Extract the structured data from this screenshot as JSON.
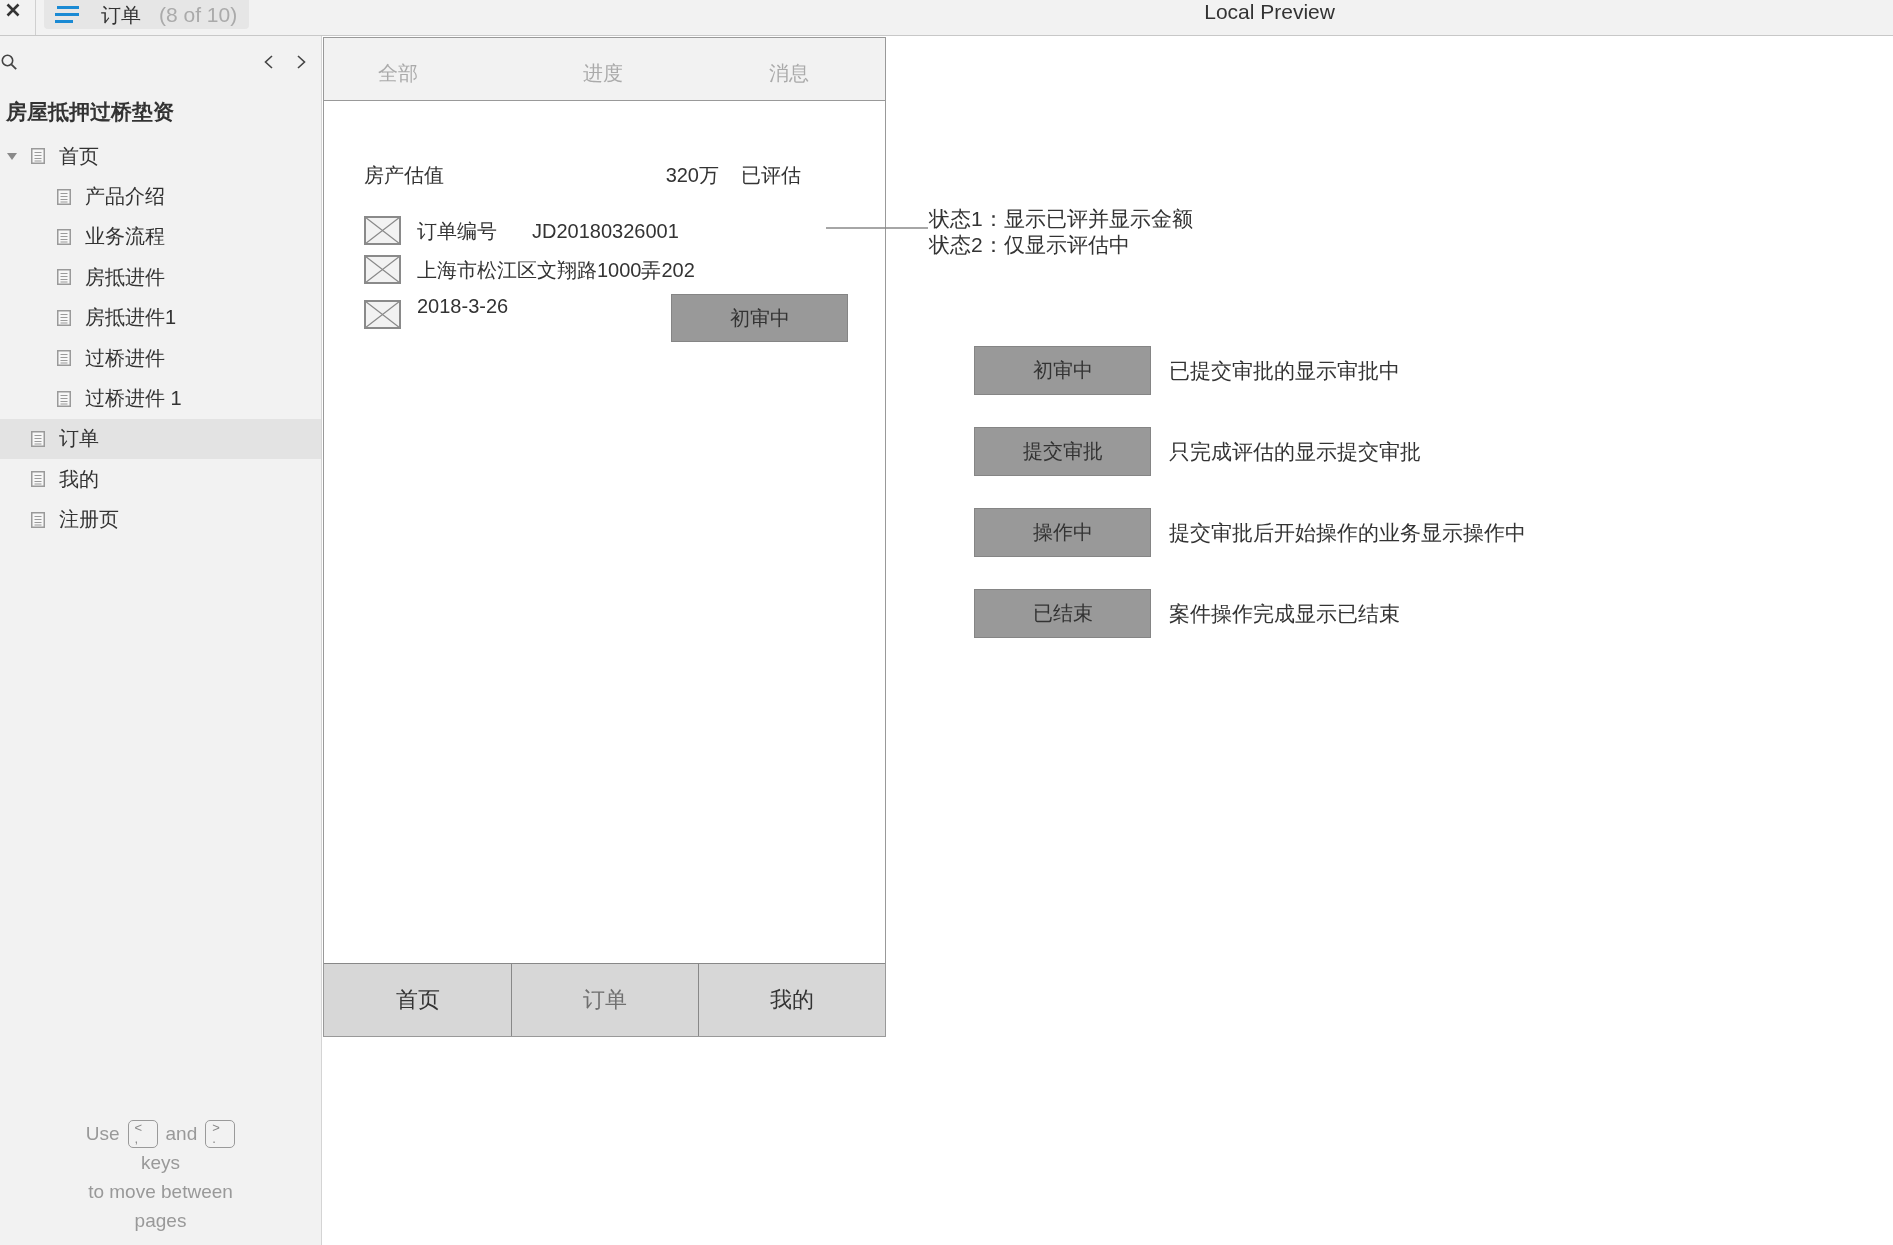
{
  "toolbar": {
    "page_title": "订单",
    "page_count": "(8 of 10)",
    "title": "Local Preview"
  },
  "sidebar": {
    "project_title": "房屋抵押过桥垫资",
    "pages": [
      {
        "label": "首页",
        "selected": false,
        "expanded": true,
        "children": [
          {
            "label": "产品介绍",
            "selected": false
          },
          {
            "label": "业务流程",
            "selected": false
          },
          {
            "label": "房抵进件",
            "selected": false
          },
          {
            "label": "房抵进件1",
            "selected": false
          },
          {
            "label": "过桥进件",
            "selected": false
          },
          {
            "label": "过桥进件 1",
            "selected": false
          }
        ]
      },
      {
        "label": "订单",
        "selected": true
      },
      {
        "label": "我的",
        "selected": false
      },
      {
        "label": "注册页",
        "selected": false
      }
    ],
    "hint": {
      "lead": "Use",
      "joiner": "and",
      "keys": [
        {
          "upper": "<",
          "lower": ","
        },
        {
          "upper": ">",
          "lower": "."
        }
      ],
      "lines": [
        "keys",
        "to move between",
        "pages"
      ]
    }
  },
  "phone": {
    "tabs": [
      "全部",
      "进度",
      "消息"
    ],
    "valuation": {
      "label": "房产估值",
      "amount": "320万",
      "status": "已评估"
    },
    "order": {
      "number_label": "订单编号",
      "number": "JD20180326001",
      "address": "上海市松江区文翔路1000弄202",
      "date": "2018-3-26",
      "status_button": "初审中"
    },
    "nav": [
      {
        "label": "首页",
        "selected": false
      },
      {
        "label": "订单",
        "selected": true
      },
      {
        "label": "我的",
        "selected": false
      }
    ]
  },
  "notes": [
    "状态1：显示已评并显示金额",
    "状态2：仅显示评估中"
  ],
  "status_legend": [
    {
      "label": "初审中",
      "description": "已提交审批的显示审批中"
    },
    {
      "label": "提交审批",
      "description": "只完成评估的显示提交审批"
    },
    {
      "label": "操作中",
      "description": "提交审批后开始操作的业务显示操作中"
    },
    {
      "label": "已结束",
      "description": "案件操作完成显示已结束"
    }
  ]
}
